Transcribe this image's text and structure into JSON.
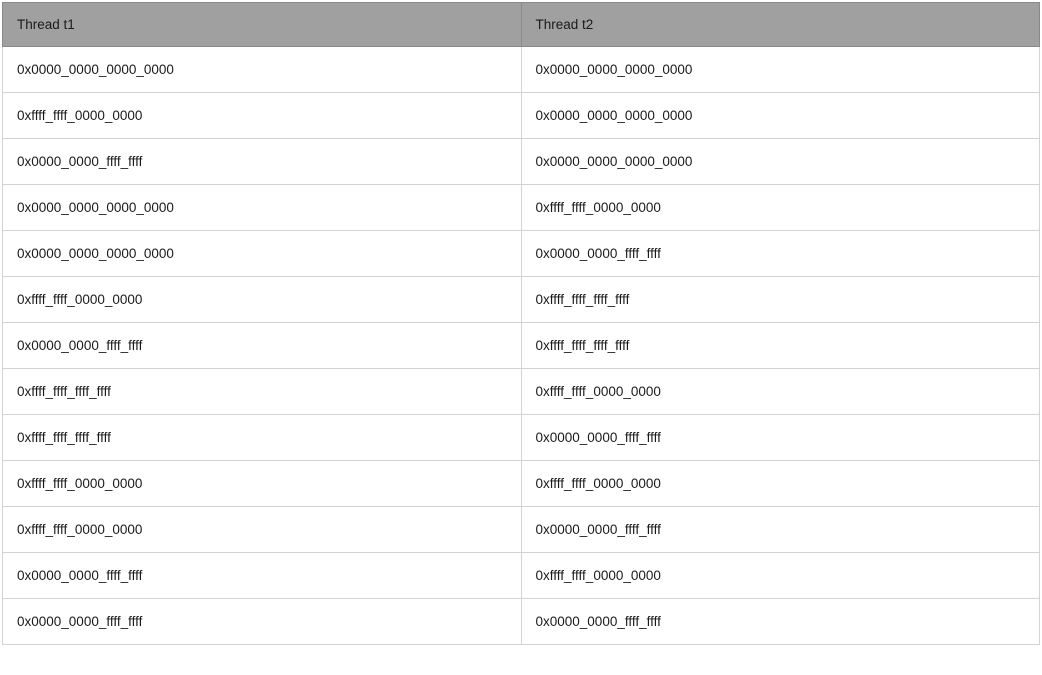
{
  "table": {
    "headers": {
      "col1": "Thread t1",
      "col2": "Thread t2"
    },
    "rows": [
      {
        "t1": "0x0000_0000_0000_0000",
        "t2": "0x0000_0000_0000_0000"
      },
      {
        "t1": "0xffff_ffff_0000_0000",
        "t2": "0x0000_0000_0000_0000"
      },
      {
        "t1": "0x0000_0000_ffff_ffff",
        "t2": "0x0000_0000_0000_0000"
      },
      {
        "t1": "0x0000_0000_0000_0000",
        "t2": "0xffff_ffff_0000_0000"
      },
      {
        "t1": "0x0000_0000_0000_0000",
        "t2": "0x0000_0000_ffff_ffff"
      },
      {
        "t1": "0xffff_ffff_0000_0000",
        "t2": "0xffff_ffff_ffff_ffff"
      },
      {
        "t1": "0x0000_0000_ffff_ffff",
        "t2": "0xffff_ffff_ffff_ffff"
      },
      {
        "t1": "0xffff_ffff_ffff_ffff",
        "t2": "0xffff_ffff_0000_0000"
      },
      {
        "t1": "0xffff_ffff_ffff_ffff",
        "t2": "0x0000_0000_ffff_ffff"
      },
      {
        "t1": "0xffff_ffff_0000_0000",
        "t2": "0xffff_ffff_0000_0000"
      },
      {
        "t1": "0xffff_ffff_0000_0000",
        "t2": "0x0000_0000_ffff_ffff"
      },
      {
        "t1": "0x0000_0000_ffff_ffff",
        "t2": "0xffff_ffff_0000_0000"
      },
      {
        "t1": "0x0000_0000_ffff_ffff",
        "t2": "0x0000_0000_ffff_ffff"
      }
    ]
  }
}
